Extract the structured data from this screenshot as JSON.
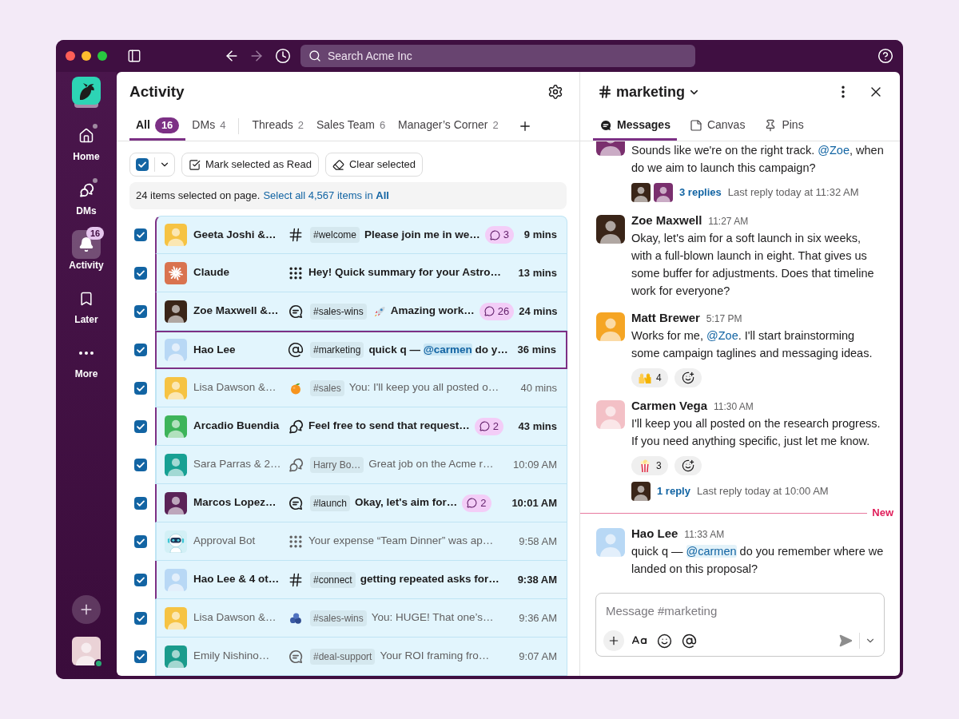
{
  "title_bar": {
    "back_disabled": false,
    "forward_disabled": true,
    "search_placeholder": "Search Acme Inc"
  },
  "sidebar": {
    "items": [
      {
        "label": "Home",
        "kind": "home",
        "selected": false,
        "dot": true
      },
      {
        "label": "DMs",
        "kind": "dms",
        "selected": false,
        "dot": true
      },
      {
        "label": "Activity",
        "kind": "activity",
        "selected": true,
        "dot": false,
        "badge": "16"
      },
      {
        "label": "Later",
        "kind": "later",
        "selected": false,
        "dot": false
      },
      {
        "label": "More",
        "kind": "more",
        "selected": false,
        "dot": false
      }
    ],
    "user": {
      "color": "#ead2d6",
      "online": true
    }
  },
  "activity": {
    "title": "Activity",
    "tab_groups": [
      [
        {
          "label": "All",
          "count": "16",
          "selected": true
        },
        {
          "label": "DMs",
          "count": "4",
          "selected": false
        }
      ],
      [
        {
          "label": "Threads",
          "count": "2",
          "selected": false
        },
        {
          "label": "Sales Team",
          "count": "6",
          "selected": false
        },
        {
          "label": "Manager’s Corner",
          "count": "2",
          "selected": false
        }
      ]
    ],
    "select_all_checked": true,
    "actions": [
      {
        "kind": "mark-read",
        "label": "Mark selected as Read"
      },
      {
        "kind": "clear",
        "label": "Clear selected"
      }
    ],
    "selection_notice": {
      "text": "24 items selected on page.",
      "link": "Select all 4,567 items in **All**"
    },
    "rows": [
      {
        "kind": "channel",
        "checked": true,
        "unread": true,
        "focused": false,
        "avatar": {
          "kind": "photo",
          "color": "#f6c343"
        },
        "name": "Geeta Joshi &…",
        "tag": "#welcome",
        "preview": [
          {
            "kind": "text",
            "text": "Please join me in we…"
          }
        ],
        "replies": "3",
        "time": "9 mins"
      },
      {
        "kind": "app",
        "checked": true,
        "unread": true,
        "focused": false,
        "avatar": {
          "kind": "logo",
          "color": "#d9734f"
        },
        "name": "Claude",
        "preview": [
          {
            "kind": "text",
            "text": "Hey! Quick summary for your Astro…"
          }
        ],
        "time": "13 mins"
      },
      {
        "kind": "thread",
        "checked": true,
        "unread": true,
        "focused": false,
        "avatar": {
          "kind": "photo",
          "color": "#3a2518"
        },
        "name": "Zoe Maxwell &…",
        "tag": "#sales-wins",
        "preview": [
          {
            "kind": "rocket"
          },
          {
            "kind": "text",
            "text": "Amazing work…"
          }
        ],
        "replies": "26",
        "time": "24 mins"
      },
      {
        "kind": "mention",
        "checked": true,
        "unread": true,
        "focused": true,
        "avatar": {
          "kind": "photo",
          "color": "#b8d8f5"
        },
        "name": "Hao Lee",
        "tag": "#marketing",
        "preview": [
          {
            "kind": "text",
            "text": "quick q — "
          },
          {
            "kind": "my-mention",
            "text": "@carmen"
          },
          {
            "kind": "text",
            "text": " do y…"
          }
        ],
        "time": "36 mins"
      },
      {
        "kind": "tangerine",
        "checked": true,
        "unread": false,
        "focused": false,
        "avatar": {
          "kind": "photo",
          "color": "#f6c343"
        },
        "name": "Lisa Dawson &…",
        "tag": "#sales",
        "preview": [
          {
            "kind": "text",
            "text": "You: I'll keep you all posted o…"
          }
        ],
        "time": "40 mins"
      },
      {
        "kind": "dm",
        "checked": true,
        "unread": true,
        "focused": false,
        "avatar": {
          "kind": "photo",
          "color": "#3db45a"
        },
        "name": "Arcadio Buendia",
        "preview": [
          {
            "kind": "text",
            "text": "Feel free to send that request…"
          }
        ],
        "replies": "2",
        "time": "43 mins"
      },
      {
        "kind": "dm",
        "checked": true,
        "unread": false,
        "focused": false,
        "avatar": {
          "kind": "photo",
          "color": "#17a093"
        },
        "name": "Sara Parras & 2…",
        "tag": "Harry Bo…",
        "preview": [
          {
            "kind": "text",
            "text": "Great job on the Acme r…"
          }
        ],
        "time": "10:09 AM"
      },
      {
        "kind": "thread",
        "checked": true,
        "unread": true,
        "focused": false,
        "avatar": {
          "kind": "photo",
          "color": "#5a2357"
        },
        "name": "Marcos Lopez…",
        "tag": "#launch",
        "preview": [
          {
            "kind": "text",
            "text": "Okay, let's aim for…"
          }
        ],
        "replies": "2",
        "time": "10:01 AM"
      },
      {
        "kind": "app",
        "checked": true,
        "unread": false,
        "focused": false,
        "avatar": {
          "kind": "bot",
          "color": "#d3f0f6"
        },
        "name": "Approval Bot",
        "preview": [
          {
            "kind": "text",
            "text": "Your expense “Team Dinner” was ap…"
          }
        ],
        "time": "9:58 AM"
      },
      {
        "kind": "channel",
        "checked": true,
        "unread": true,
        "focused": false,
        "avatar": {
          "kind": "photo",
          "color": "#b8d8f5"
        },
        "name": "Hao Lee & 4 ot…",
        "tag": "#connect",
        "preview": [
          {
            "kind": "text",
            "text": "getting repeated asks for…"
          }
        ],
        "time": "9:38 AM"
      },
      {
        "kind": "blueberries",
        "checked": true,
        "unread": false,
        "focused": false,
        "avatar": {
          "kind": "photo",
          "color": "#f6c343"
        },
        "name": "Lisa Dawson &…",
        "tag": "#sales-wins",
        "preview": [
          {
            "kind": "text",
            "text": "You: HUGE! That one’s…"
          }
        ],
        "time": "9:36 AM"
      },
      {
        "kind": "thread",
        "checked": true,
        "unread": false,
        "focused": false,
        "avatar": {
          "kind": "photo",
          "color": "#1a9b8c"
        },
        "name": "Emily Nishino…",
        "tag": "#deal-support",
        "preview": [
          {
            "kind": "text",
            "text": "Your ROI framing fro…"
          }
        ],
        "time": "9:07 AM"
      }
    ]
  },
  "channel": {
    "name": "marketing",
    "tabs": [
      {
        "label": "Messages",
        "kind": "messages",
        "selected": true
      },
      {
        "label": "Canvas",
        "kind": "canvas",
        "selected": false
      },
      {
        "label": "Pins",
        "kind": "pins",
        "selected": false
      }
    ],
    "messages": [
      {
        "kind": "message",
        "avatar": {
          "kind": "photo",
          "color": "#7a2f6e"
        },
        "body": [
          {
            "kind": "text",
            "text": "Sounds like we're on the right track. "
          },
          {
            "kind": "mention",
            "text": "@Zoe"
          },
          {
            "kind": "text",
            "text": ", when do we aim to launch this campaign?"
          }
        ],
        "thread": {
          "avatars": [
            {
              "kind": "photo",
              "color": "#3a2518"
            },
            {
              "kind": "photo",
              "color": "#7a2f6e"
            }
          ],
          "replies": "3 replies",
          "last_reply": "Last reply today at 11:32 AM"
        }
      },
      {
        "kind": "message",
        "author": "Zoe Maxwell",
        "time": "11:27 AM",
        "avatar": {
          "kind": "photo",
          "color": "#3a2518"
        },
        "body": [
          {
            "kind": "text",
            "text": "Okay, let's aim for a soft launch in six weeks, with a full-blown launch in eight. That gives us some buffer for adjustments. Does that timeline work for everyone?"
          }
        ]
      },
      {
        "kind": "message",
        "author": "Matt Brewer",
        "time": "5:17 PM",
        "avatar": {
          "kind": "photo",
          "color": "#f5a524"
        },
        "body": [
          {
            "kind": "text",
            "text": "Works for me, "
          },
          {
            "kind": "mention",
            "text": "@Zoe"
          },
          {
            "kind": "text",
            "text": ". I'll start brainstorming some campaign taglines and messaging ideas."
          }
        ],
        "reactions": [
          {
            "kind": "raised-hands",
            "count": "4"
          }
        ]
      },
      {
        "kind": "message",
        "author": "Carmen Vega",
        "time": "11:30 AM",
        "avatar": {
          "kind": "photo",
          "color": "#f3c0c6"
        },
        "body": [
          {
            "kind": "text",
            "text": "I'll keep you all posted on the research progress. If you need anything specific, just let me know."
          }
        ],
        "reactions": [
          {
            "kind": "popcorn",
            "count": "3"
          }
        ],
        "thread": {
          "avatars": [
            {
              "kind": "photo",
              "color": "#3a2518"
            }
          ],
          "replies": "1 reply",
          "last_reply": "Last reply today at 10:00 AM"
        }
      },
      {
        "kind": "new-divider",
        "label": "New"
      },
      {
        "kind": "message",
        "author": "Hao Lee",
        "time": "11:33 AM",
        "avatar": {
          "kind": "photo",
          "color": "#b8d8f5"
        },
        "body": [
          {
            "kind": "text",
            "text": "quick q — "
          },
          {
            "kind": "my-mention",
            "text": "@carmen"
          },
          {
            "kind": "text",
            "text": " do you remember where we landed on this proposal?"
          }
        ]
      }
    ],
    "composer": {
      "placeholder": "Message #marketing"
    }
  }
}
